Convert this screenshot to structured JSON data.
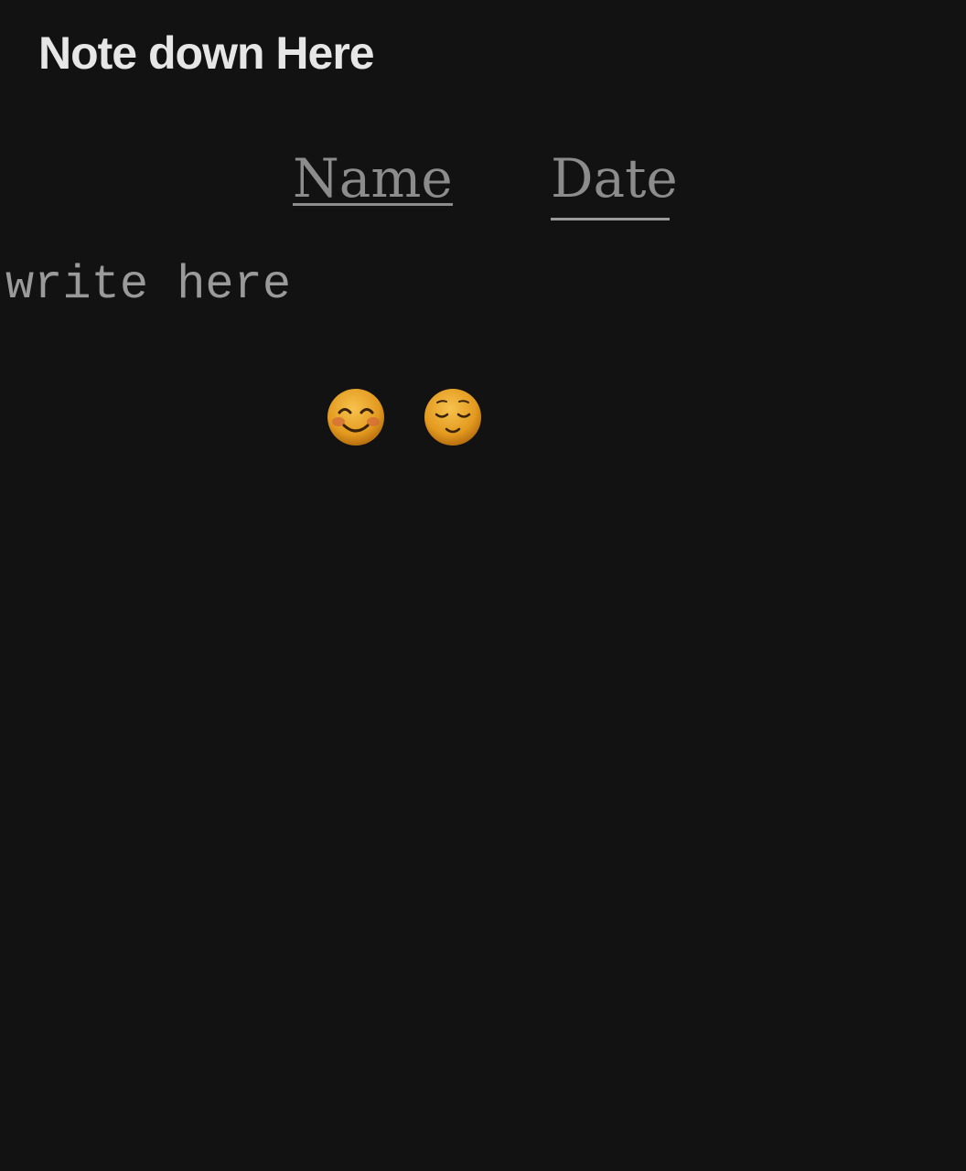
{
  "app": {
    "title": "Note down Here"
  },
  "fields": {
    "name_label": "Name",
    "date_label": "Date"
  },
  "note": {
    "text": "write here",
    "emojis": [
      "smiling-face-with-smiling-eyes-icon",
      "relieved-face-icon"
    ]
  },
  "colors": {
    "background": "#121212",
    "title_text": "#e6e6e6",
    "field_text": "#8c8c8c",
    "note_text": "#9a9a9a"
  }
}
